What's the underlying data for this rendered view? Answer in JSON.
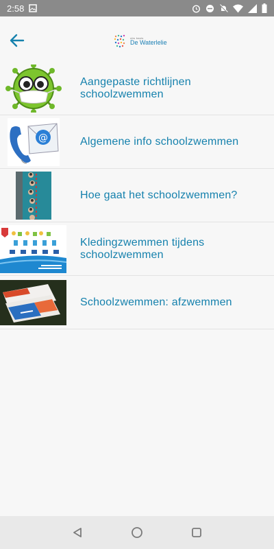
{
  "status_bar": {
    "time": "2:58",
    "icons": [
      "image-icon",
      "alarm-icon",
      "dnd-icon",
      "bell-off-icon",
      "wifi-icon",
      "signal-icon",
      "battery-icon"
    ]
  },
  "app_bar": {
    "back_icon": "arrow-left-icon",
    "logo_small": "obs basis",
    "logo_name": "De Waterlelie"
  },
  "accent_color": "#1581ad",
  "items": [
    {
      "title": "Aangepaste richtlijnen schoolzwemmen",
      "thumb": "virus-mascot"
    },
    {
      "title": "Algemene info schoolzwemmen",
      "thumb": "phone-email"
    },
    {
      "title": "Hoe gaat het schoolzwemmen?",
      "thumb": "swimming-pool"
    },
    {
      "title": "Kledingzwemmen tijdens schoolzwemmen",
      "thumb": "clothing-poster"
    },
    {
      "title": "Schoolzwemmen: afzwemmen",
      "thumb": "swim-diplomas"
    }
  ],
  "nav_bar": {
    "icons": [
      "back-triangle-icon",
      "home-circle-icon",
      "recents-square-icon"
    ]
  }
}
